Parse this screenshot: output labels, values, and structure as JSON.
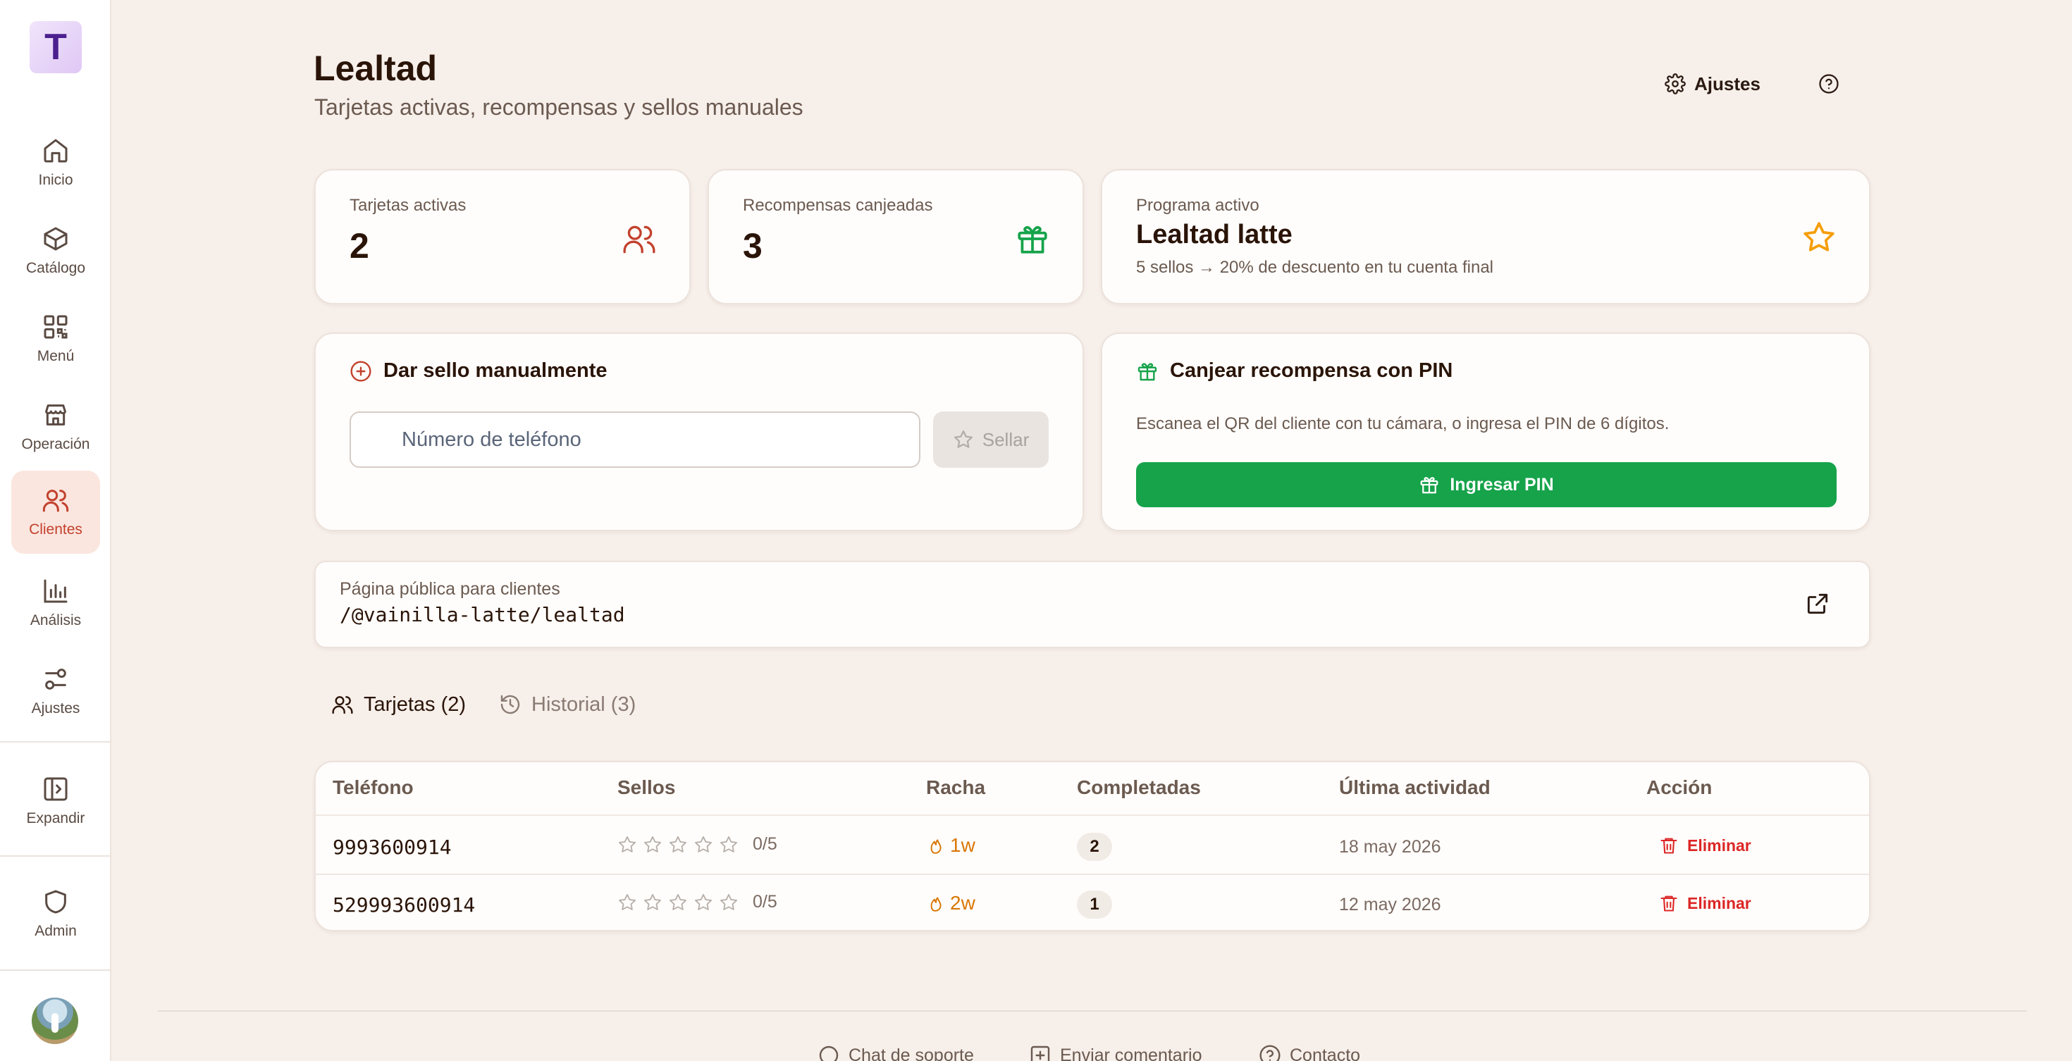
{
  "brand": {
    "logo_letter": "T"
  },
  "sidebar": {
    "items": [
      {
        "label": "Inicio",
        "icon": "home-icon"
      },
      {
        "label": "Catálogo",
        "icon": "box-icon"
      },
      {
        "label": "Menú",
        "icon": "qr-code-icon"
      },
      {
        "label": "Operación",
        "icon": "store-icon"
      },
      {
        "label": "Clientes",
        "icon": "users-icon",
        "active": true
      },
      {
        "label": "Análisis",
        "icon": "bar-chart-icon"
      },
      {
        "label": "Ajustes",
        "icon": "sliders-icon"
      }
    ],
    "expand_label": "Expandir",
    "admin_label": "Admin"
  },
  "header": {
    "title": "Lealtad",
    "subtitle": "Tarjetas activas, recompensas y sellos manuales",
    "settings_label": "Ajustes"
  },
  "stats": {
    "active_cards": {
      "label": "Tarjetas activas",
      "value": "2"
    },
    "rewards": {
      "label": "Recompensas canjeadas",
      "value": "3"
    },
    "program": {
      "label": "Programa activo",
      "name": "Lealtad latte",
      "description": "5 sellos → 20% de descuento en tu cuenta final"
    }
  },
  "manual_stamp": {
    "title": "Dar sello manualmente",
    "phone_placeholder": "Número de teléfono",
    "phone_value": "",
    "button_label": "Sellar"
  },
  "pin_redeem": {
    "title": "Canjear recompensa con PIN",
    "description": "Escanea el QR del cliente con tu cámara, o ingresa el PIN de 6 dígitos.",
    "button_label": "Ingresar PIN"
  },
  "public_page": {
    "label": "Página pública para clientes",
    "url": "/@vainilla-latte/lealtad"
  },
  "tabs": [
    {
      "label": "Tarjetas (2)",
      "active": true
    },
    {
      "label": "Historial (3)",
      "active": false
    }
  ],
  "table": {
    "headers": [
      "Teléfono",
      "Sellos",
      "Racha",
      "Completadas",
      "Última actividad",
      "Acción"
    ],
    "rows": [
      {
        "phone": "9993600914",
        "stamps": 0,
        "stamps_total": 5,
        "stamps_text": "0/5",
        "streak": "1w",
        "completed": "2",
        "last_activity": "18 may 2026",
        "action": "Eliminar"
      },
      {
        "phone": "529993600914",
        "stamps": 0,
        "stamps_total": 5,
        "stamps_text": "0/5",
        "streak": "2w",
        "completed": "1",
        "last_activity": "12 may 2026",
        "action": "Eliminar"
      }
    ]
  },
  "footer": {
    "links": [
      {
        "label": "Chat de soporte",
        "icon": "chat-icon"
      },
      {
        "label": "Enviar comentario",
        "icon": "feedback-icon"
      },
      {
        "label": "Contacto",
        "icon": "help-icon"
      }
    ]
  },
  "colors": {
    "background": "#f7efea",
    "accent": "#c2412d",
    "success": "#16a34a",
    "star": "#f59e0b",
    "danger": "#dc2626"
  }
}
